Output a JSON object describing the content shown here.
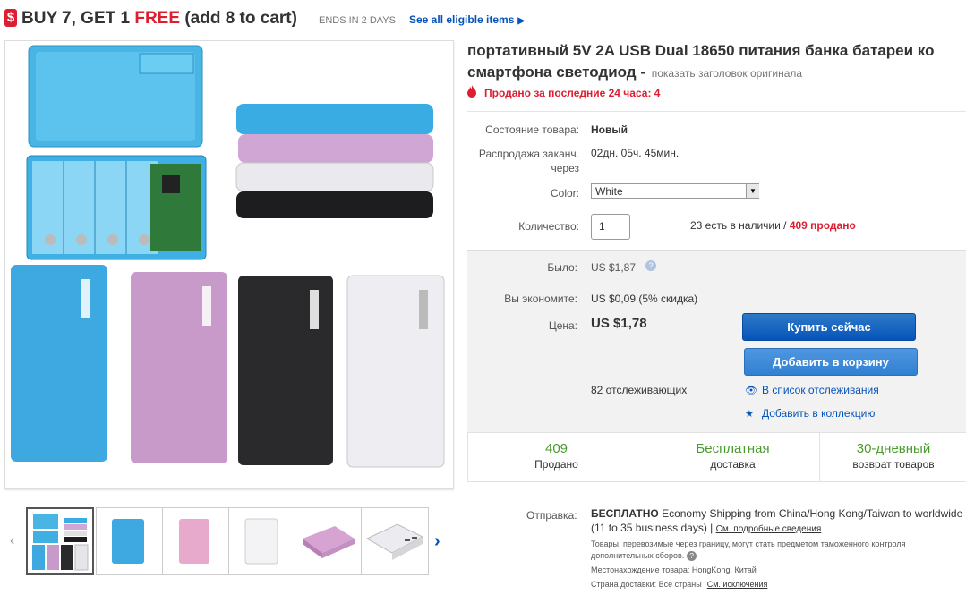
{
  "promo": {
    "icon": "$",
    "lead": "BUY 7, GET 1 ",
    "free": "FREE",
    "add": " (add 8 to cart)",
    "ends": "ENDS IN 2 DAYS",
    "link": "See all eligible items",
    "accent": "#dd1e31"
  },
  "title": {
    "line1": "портативный 5V 2A USB Dual 18650 питания банка батареи ко",
    "line2": "смартфона светодиод -",
    "original_link": "показать заголовок оригинала"
  },
  "sold_24h": "Продано за последние 24 часа: 4",
  "condition": {
    "label": "Состояние товара:",
    "value": "Новый"
  },
  "sale_end": {
    "label_line1": "Распродажа заканч.",
    "label_line2": "через",
    "value": "02дн. 05ч. 45мин."
  },
  "color": {
    "label": "Color:",
    "selected": "White"
  },
  "quantity": {
    "label": "Количество:",
    "value": "1",
    "available": "23 есть в наличии /",
    "sold": "409 продано"
  },
  "price": {
    "was_label": "Было:",
    "was_value": "US $1,87",
    "save_label": "Вы экономите:",
    "save_value": "US $0,09 (5% скидка)",
    "price_label": "Цена:",
    "price_value": "US $1,78"
  },
  "buttons": {
    "buy_now": "Купить сейчас",
    "add_to_cart": "Добавить в корзину",
    "brand_color": "#0654ba"
  },
  "watchers": "82 отслеживающих",
  "actions": {
    "watchlist": "В список отслеживания",
    "collection": "Добавить в коллекцию"
  },
  "stats": [
    {
      "big": "409",
      "small": "Продано"
    },
    {
      "big": "Бесплатная",
      "small": "доставка"
    },
    {
      "big": "30-дневный",
      "small": "возврат товаров"
    }
  ],
  "shipping": {
    "label": "Отправка:",
    "free": "БЕСПЛАТНО",
    "text": " Economy Shipping from China/Hong Kong/Taiwan to worldwide (11 to 35 business days) | ",
    "details_link": "См. подробные сведения",
    "customs": "Товары, перевозимые через границу, могут стать предметом таможенного контроля дополнительных сборов.",
    "location": "Местонахождение товара: HongKong, Китай",
    "destinations": "Страна доставки: Все страны",
    "exclusions_link": "См. исключения"
  }
}
